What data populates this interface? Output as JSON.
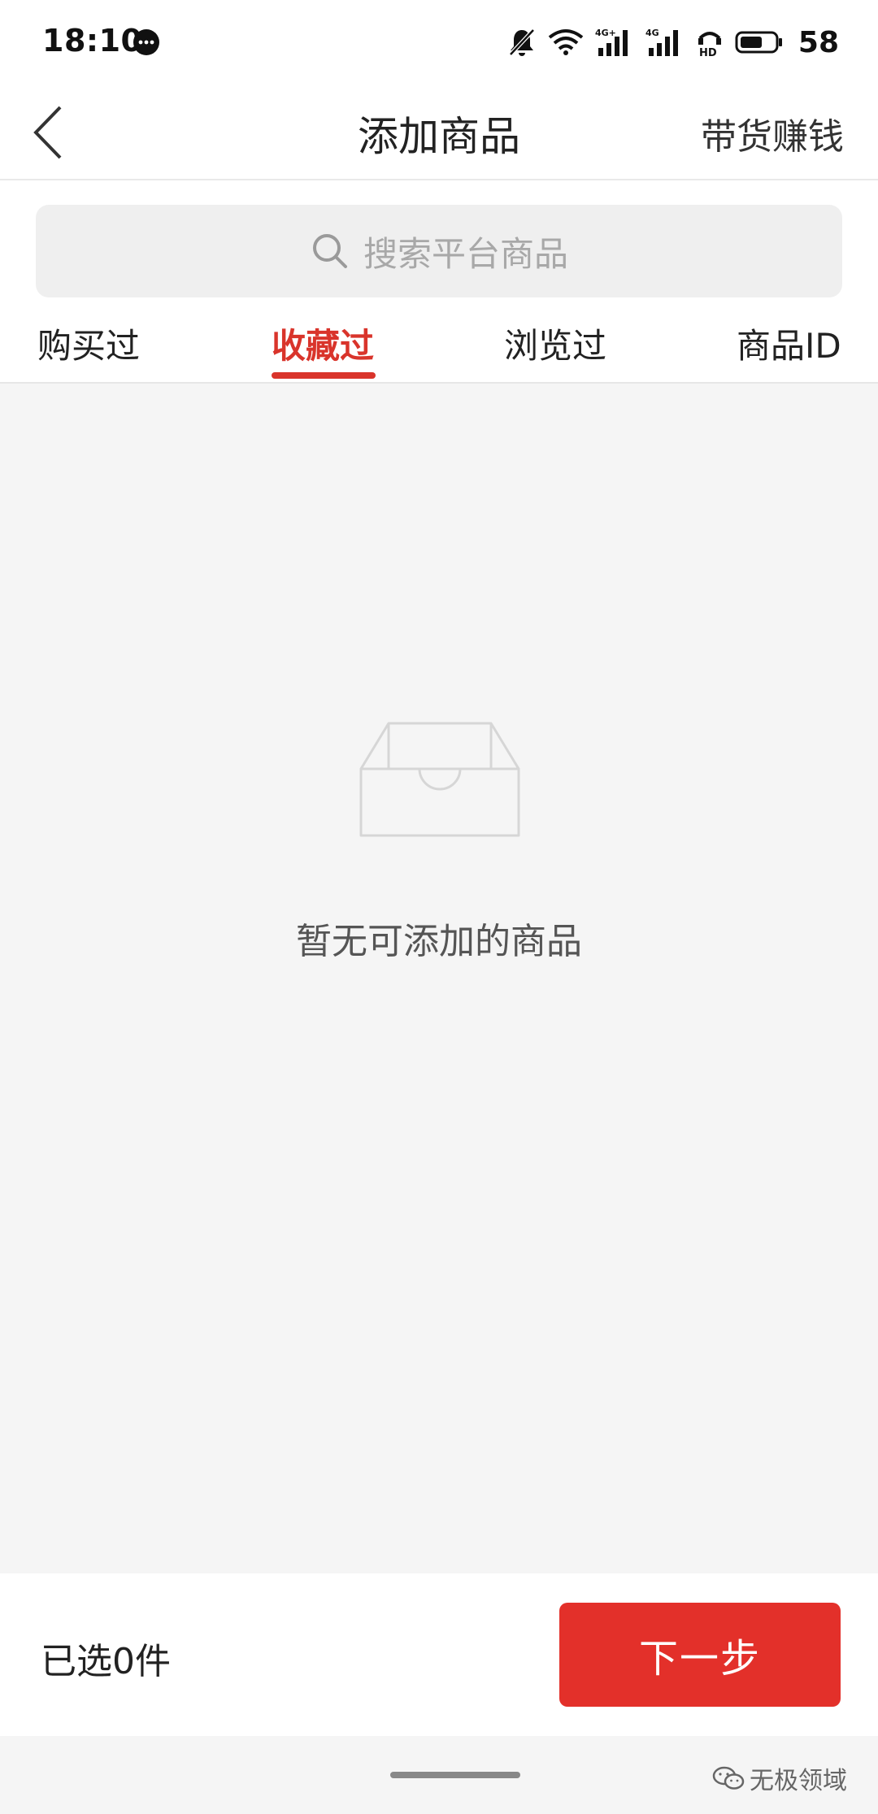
{
  "status_bar": {
    "time": "18:10",
    "battery": "58",
    "network_labels": [
      "4G+",
      "4G"
    ],
    "hd_label": "HD"
  },
  "nav": {
    "title": "添加商品",
    "action": "带货赚钱"
  },
  "search": {
    "placeholder": "搜索平台商品"
  },
  "tabs": [
    {
      "label": "购买过",
      "active": false
    },
    {
      "label": "收藏过",
      "active": true
    },
    {
      "label": "浏览过",
      "active": false
    },
    {
      "label": "商品ID",
      "active": false
    }
  ],
  "empty_state": {
    "message": "暂无可添加的商品"
  },
  "footer": {
    "selected_text": "已选0件",
    "next_label": "下一步"
  },
  "watermark": {
    "text": "无极领域"
  },
  "colors": {
    "accent": "#e3302a",
    "active_tab": "#d9342b",
    "page_bg": "#f5f5f5"
  }
}
